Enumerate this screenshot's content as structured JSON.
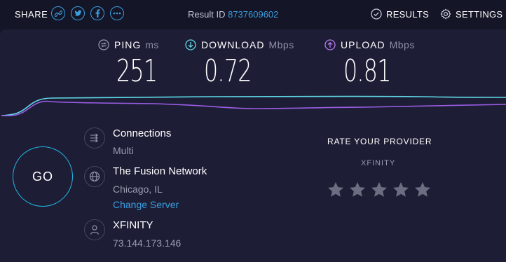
{
  "header": {
    "share_label": "SHARE",
    "share_buttons": [
      {
        "icon": "link-icon",
        "glyph": "∞"
      },
      {
        "icon": "twitter-icon",
        "glyph": "t"
      },
      {
        "icon": "facebook-icon",
        "glyph": "f"
      },
      {
        "icon": "more-icon",
        "glyph": "•••"
      }
    ],
    "result_id_label": "Result ID",
    "result_id_value": "8737609602",
    "results_label": "RESULTS",
    "settings_label": "SETTINGS"
  },
  "metrics": {
    "ping": {
      "label": "PING",
      "unit": "ms",
      "value": "251"
    },
    "download": {
      "label": "DOWNLOAD",
      "unit": "Mbps",
      "value": "0.72"
    },
    "upload": {
      "label": "UPLOAD",
      "unit": "Mbps",
      "value": "0.81"
    }
  },
  "go_label": "GO",
  "connection": {
    "connections_title": "Connections",
    "connections_value": "Multi",
    "server_name": "The Fusion Network",
    "server_location": "Chicago, IL",
    "change_server_label": "Change Server",
    "isp_name": "XFINITY",
    "ip_address": "73.144.173.146"
  },
  "rating": {
    "title": "RATE YOUR PROVIDER",
    "provider": "XFINITY",
    "stars_total": 5,
    "stars_selected": 0
  },
  "colors": {
    "background": "#141526",
    "panel": "#1d1e36",
    "accent_blue": "#3a9dde",
    "download_line": "#5fd9e6",
    "upload_line": "#9b5de5",
    "star_inactive": "#6b6d80"
  }
}
